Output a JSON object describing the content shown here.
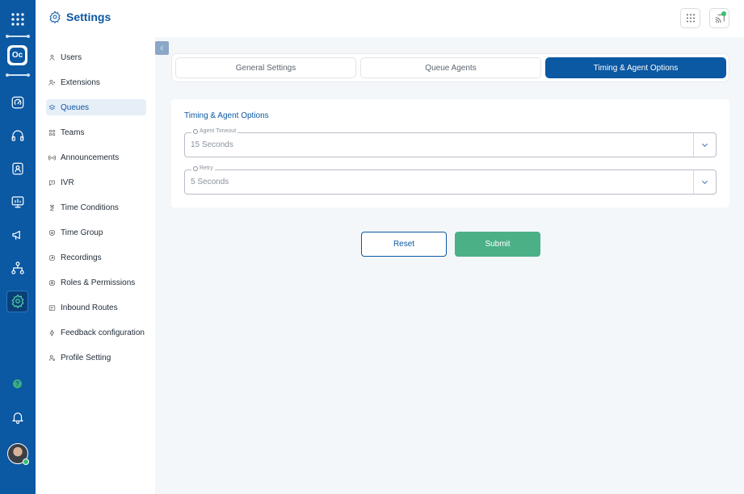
{
  "header": {
    "title": "Settings",
    "icons": {
      "title": "gear-icon",
      "dialpad": "dialpad-icon",
      "cast": "cast-icon"
    },
    "status_color": "#36c26e"
  },
  "brand": {
    "initials": "Oc"
  },
  "colors": {
    "primary": "#0b58a3",
    "accent": "#4cb087"
  },
  "rail": {
    "icons": [
      "apps-grid-icon",
      "dashboard-icon",
      "headset-icon",
      "contacts-icon",
      "monitor-icon",
      "megaphone-icon",
      "hierarchy-icon",
      "settings-icon",
      "help-icon",
      "bell-icon"
    ],
    "active": "settings-icon"
  },
  "sidebar": {
    "items": [
      {
        "label": "Users",
        "icon": "user-icon"
      },
      {
        "label": "Extensions",
        "icon": "user-plus-icon"
      },
      {
        "label": "Queues",
        "icon": "layers-icon",
        "selected": true
      },
      {
        "label": "Teams",
        "icon": "grid-icon"
      },
      {
        "label": "Announcements",
        "icon": "broadcast-icon"
      },
      {
        "label": "IVR",
        "icon": "chat-icon"
      },
      {
        "label": "Time Conditions",
        "icon": "hourglass-icon"
      },
      {
        "label": "Time Group",
        "icon": "clock-shield-icon"
      },
      {
        "label": "Recordings",
        "icon": "record-icon"
      },
      {
        "label": "Roles & Permissions",
        "icon": "permission-icon"
      },
      {
        "label": "Inbound Routes",
        "icon": "route-icon"
      },
      {
        "label": "Feedback configuration",
        "icon": "spark-icon"
      },
      {
        "label": "Profile Setting",
        "icon": "user-gear-icon"
      }
    ]
  },
  "tabs": [
    {
      "label": "General Settings"
    },
    {
      "label": "Queue Agents"
    },
    {
      "label": "Timing & Agent Options",
      "active": true
    }
  ],
  "card": {
    "title": "Timing & Agent Options",
    "fields": [
      {
        "label": "Agent Timeout",
        "value": "15 Seconds"
      },
      {
        "label": "Retry",
        "value": "5 Seconds"
      }
    ]
  },
  "actions": {
    "reset_label": "Reset",
    "submit_label": "Submit"
  }
}
